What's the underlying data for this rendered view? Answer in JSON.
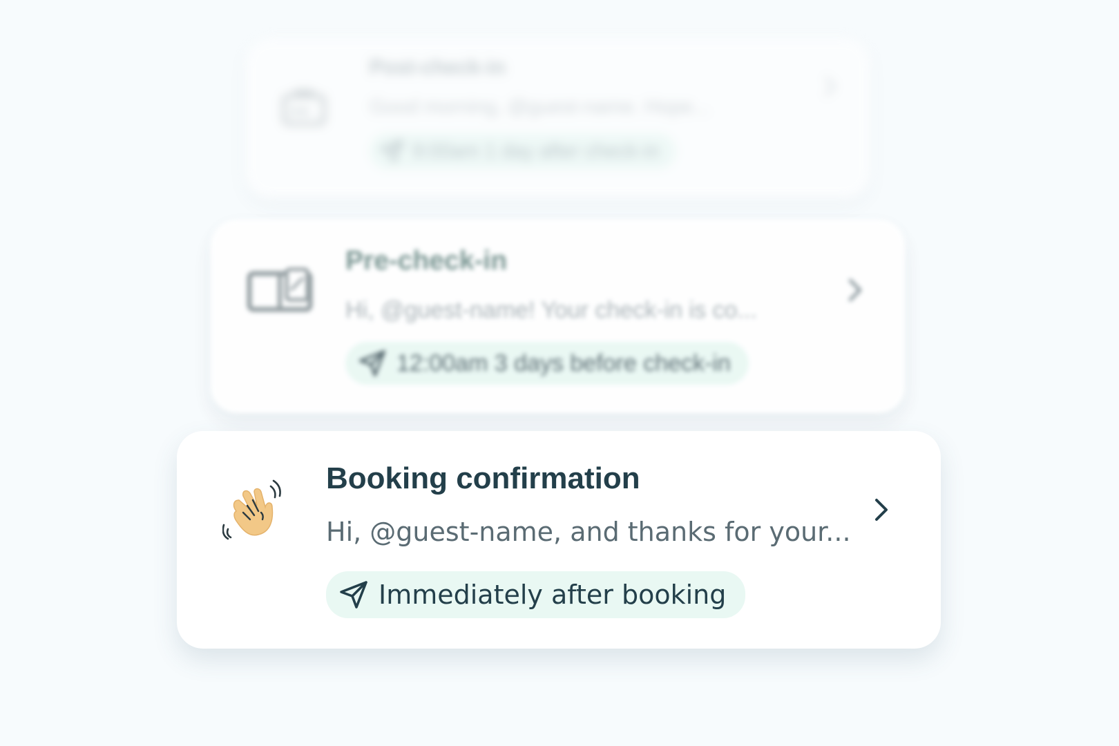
{
  "automations": [
    {
      "title": "Post-check-in",
      "preview": "Good morning, @guest-name. Hope...",
      "schedule": "9:00am 1 day after check-in",
      "icon": "night-bag-icon"
    },
    {
      "title": "Pre-check-in",
      "preview": "Hi, @guest-name! Your check-in is co...",
      "schedule": "12:00am 3 days before check-in",
      "icon": "open-book-icon"
    },
    {
      "title": "Booking confirmation",
      "preview": "Hi, @guest-name, and thanks for your...",
      "schedule": "Immediately after booking",
      "icon": "waving-hand-icon"
    }
  ],
  "colors": {
    "background": "#f7fbfd",
    "card": "#ffffff",
    "pill": "#e9f8f3",
    "title": "#233f4a"
  }
}
